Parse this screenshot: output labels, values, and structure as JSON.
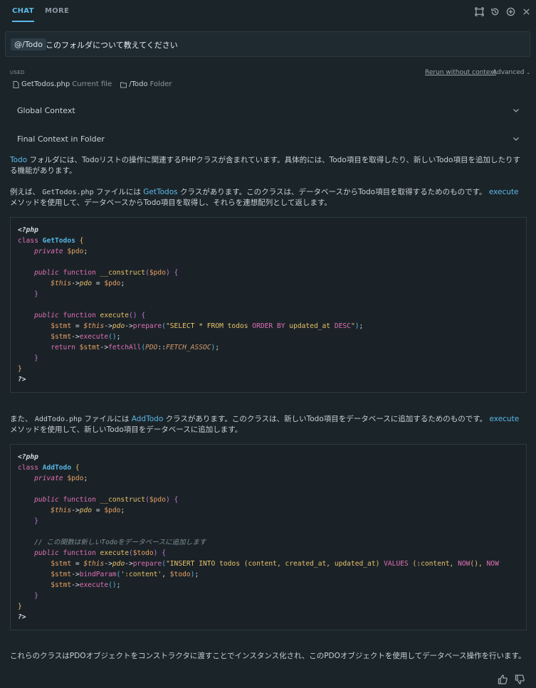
{
  "tabs": [
    "CHAT",
    "MORE"
  ],
  "query": {
    "mention": "@/Todo",
    "text": "このフォルダについて教えてください"
  },
  "context": {
    "used_label": "USED",
    "rerun_label": "Rerun without context",
    "advanced_label": "Advanced",
    "files": [
      {
        "name": "GetTodos.php",
        "sub": "Current file"
      },
      {
        "name": "/Todo",
        "sub": "Folder"
      }
    ],
    "sections": [
      "Global Context",
      "Final Context in Folder"
    ]
  },
  "answer": {
    "p1_link": "Todo",
    "p1_text": " フォルダには、Todoリストの操作に関連するPHPクラスが含まれています。具体的には、Todo項目を取得したり、新しいTodo項目を追加したりする機能があります。",
    "p2_a": "例えば、 ",
    "p2_file": "GetTodos.php",
    "p2_b": " ファイルには ",
    "p2_class": "GetTodos",
    "p2_c": " クラスがあります。このクラスは、データベースからTodo項目を取得するためのものです。 ",
    "p2_method": "execute",
    "p2_d": " メソッドを使用して、データベースからTodo項目を取得し、それらを連想配列として返します。",
    "p3_a": "また、 ",
    "p3_file": "AddTodo.php",
    "p3_b": " ファイルには ",
    "p3_class": "AddTodo",
    "p3_c": " クラスがあります。このクラスは、新しいTodo項目をデータベースに追加するためのものです。 ",
    "p3_method": "execute",
    "p3_d": " メソッドを使用して、新しいTodo項目をデータベースに追加します。",
    "p4": "これらのクラスはPDOオブジェクトをコンストラクタに渡すことでインスタンス化され、このPDOオブジェクトを使用してデータベース操作を行います。"
  },
  "code1": {
    "open": "<?php",
    "close": "?>",
    "class_kw": "class",
    "class_name": "GetTodos",
    "private_kw": "private",
    "pdo_var": "$pdo",
    "public_kw": "public",
    "function_kw": "function",
    "construct": "__construct",
    "this": "$this",
    "pdo_prop": "pdo",
    "execute": "execute",
    "stmt": "$stmt",
    "prepare": "prepare",
    "sql_a": "\"SELECT * FROM todos ",
    "sql_kw": "ORDER BY",
    "sql_b": " updated_at ",
    "sql_kw2": "DESC",
    "sql_c": "\"",
    "return_kw": "return",
    "fetchall": "fetchAll",
    "pdo_class": "PDO",
    "fetch_const": "FETCH_ASSOC"
  },
  "code2": {
    "open": "<?php",
    "close": "?>",
    "class_kw": "class",
    "class_name": "AddTodo",
    "private_kw": "private",
    "pdo_var": "$pdo",
    "public_kw": "public",
    "function_kw": "function",
    "construct": "__construct",
    "this": "$this",
    "pdo_prop": "pdo",
    "comment": "// この関数は新しいTodoをデータベースに追加します",
    "execute": "execute",
    "todo_var": "$todo",
    "stmt": "$stmt",
    "prepare": "prepare",
    "sql_a": "\"INSERT INTO todos (content, created_at, updated_at) ",
    "sql_kw": "VALUES",
    "sql_b": " (:content, ",
    "sql_now": "NOW",
    "sql_c": "(), ",
    "sql_now2": "NOW",
    "bindparam": "bindParam",
    "param_str": "':content'"
  }
}
